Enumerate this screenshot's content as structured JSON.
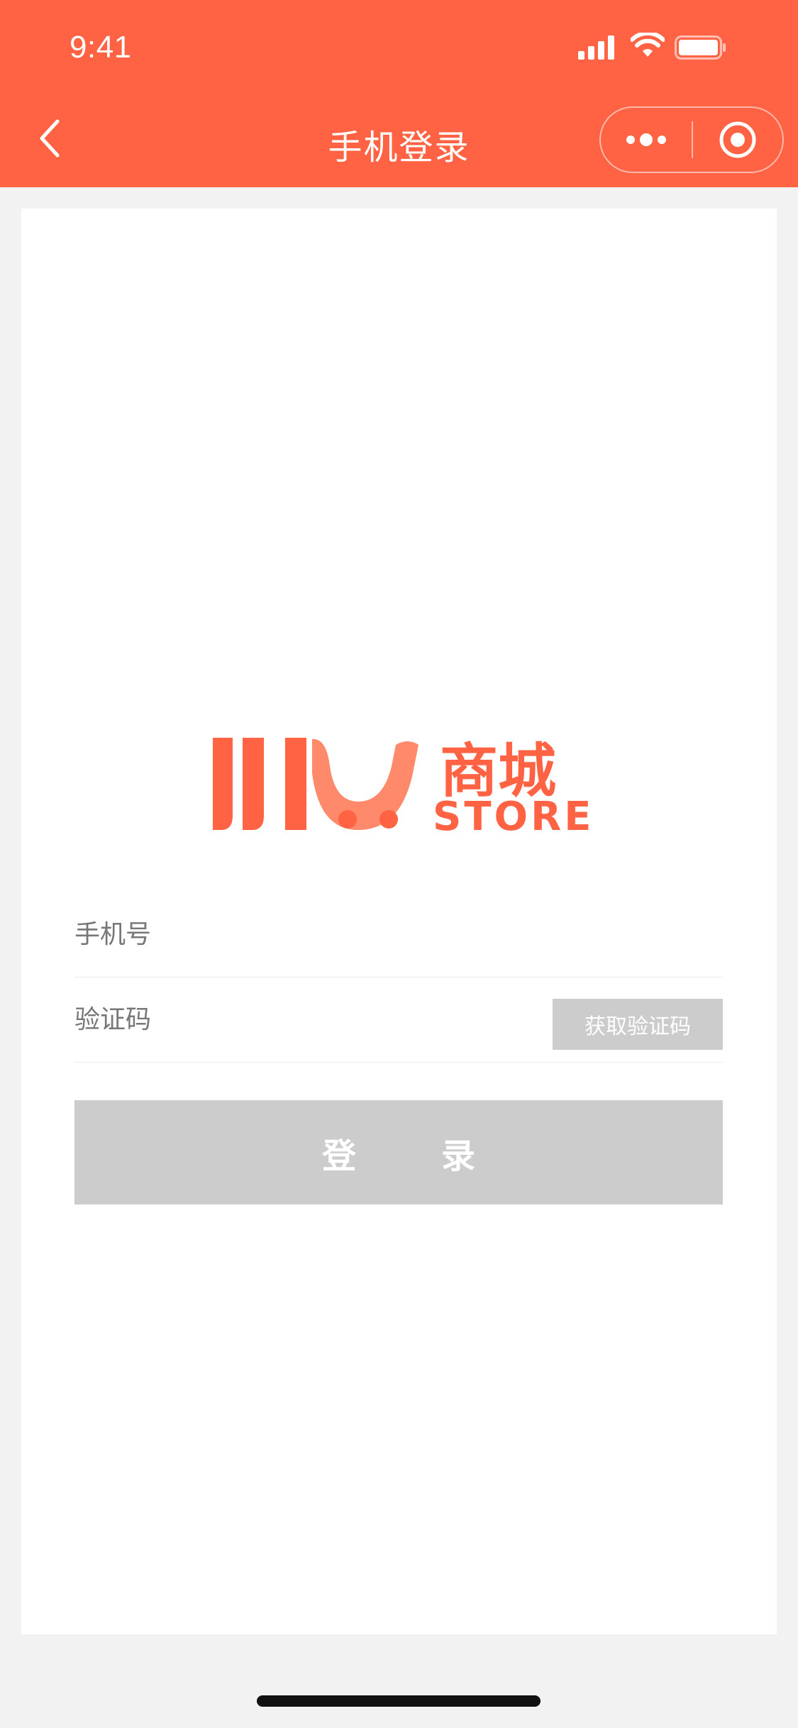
{
  "status_bar": {
    "time": "9:41"
  },
  "nav": {
    "title": "手机登录"
  },
  "logo": {
    "brand_text": "商城",
    "brand_sub": "STORE"
  },
  "form": {
    "phone_placeholder": "手机号",
    "code_placeholder": "验证码",
    "get_code_label": "获取验证码",
    "login_label": "登录"
  },
  "colors": {
    "brand": "#ff6343",
    "disabled": "#cccccc",
    "background": "#f2f2f2"
  }
}
